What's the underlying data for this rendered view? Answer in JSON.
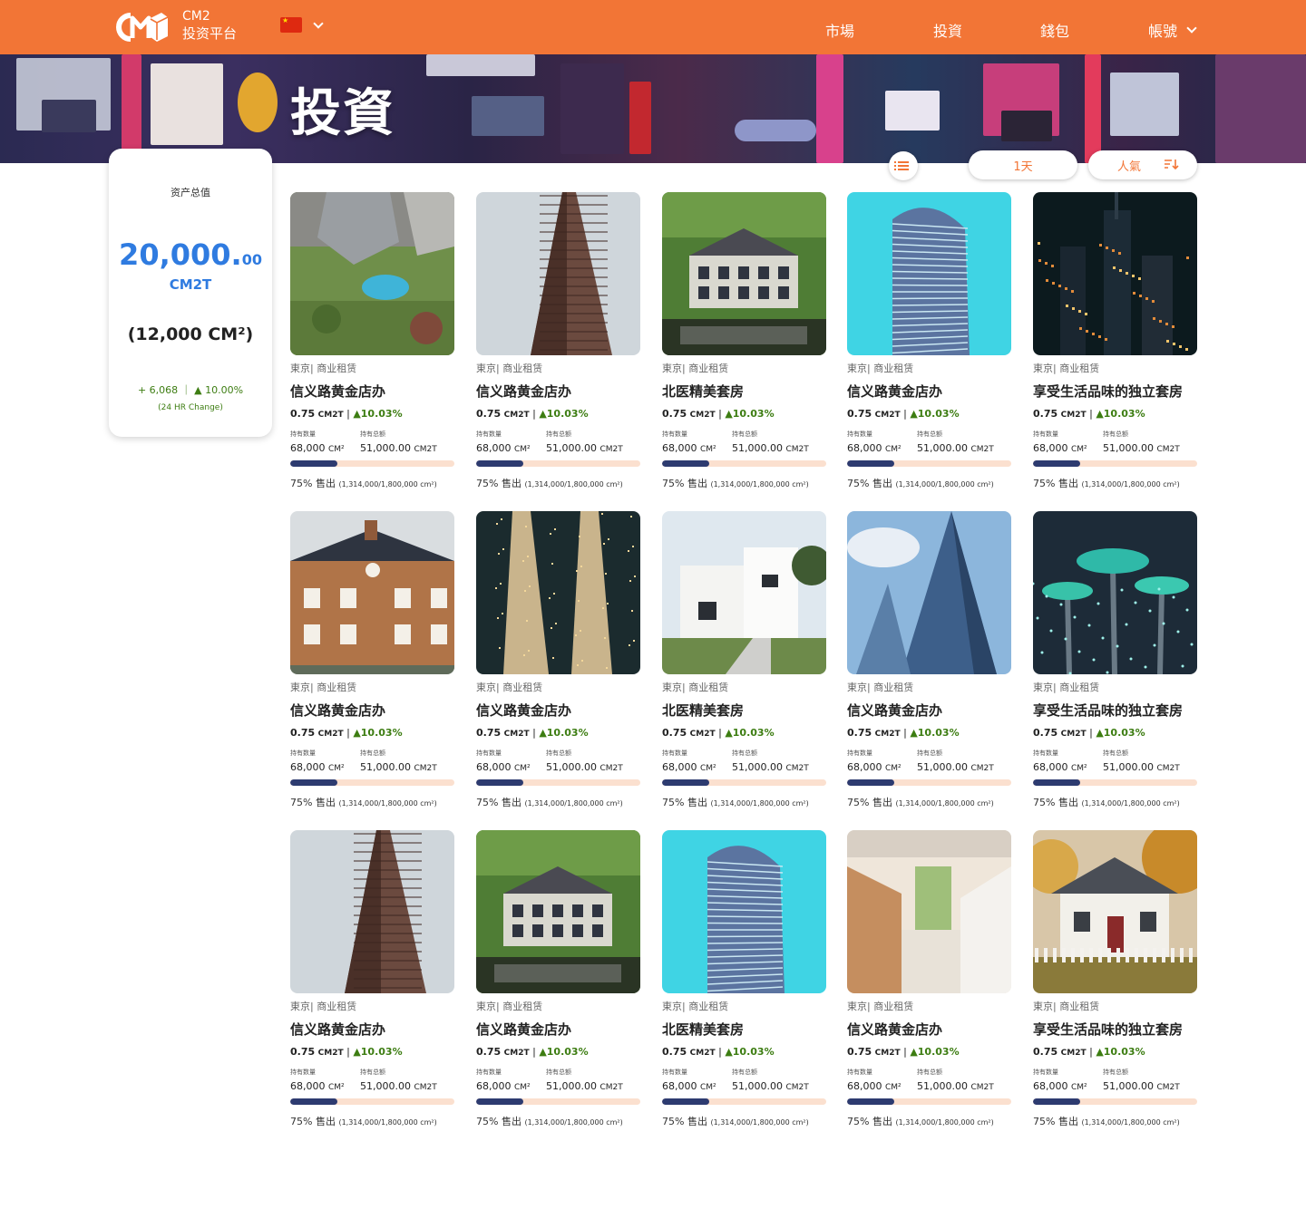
{
  "brand": {
    "line1": "CM2",
    "line2": "投资平台",
    "logo_icon": "cm2-logo-icon"
  },
  "nav": {
    "market": "市場",
    "invest": "投資",
    "wallet": "錢包",
    "account": "帳號"
  },
  "hero": {
    "title": "投資"
  },
  "summary": {
    "label": "资产总值",
    "value_main": "20,000.",
    "value_cents": "00",
    "unit": "CM2T",
    "area": "(12,000 CM²)",
    "change": "+ 6,068 ｜ ▲ 10.00%",
    "change_note": "(24 HR Change)"
  },
  "controls": {
    "period": "1天",
    "sort": "人氣"
  },
  "labels": {
    "holdings_qty": "持有数量",
    "holdings_total": "持有总额",
    "sold_word": "售出"
  },
  "colors": {
    "brand_orange": "#f27536",
    "accent_blue": "#2f7be0",
    "change_green": "#3d7d12",
    "bar_fill": "#2d3b70",
    "bar_track": "#fbe0cf"
  },
  "cards": [
    {
      "image": "aerial-house-pool",
      "category": "東京| 商业租赁",
      "name": "信义路黄金店办",
      "price": "0.75",
      "price_unit": "CM2T",
      "change": "▲10.03%",
      "qty": "68,000",
      "qty_unit": "CM²",
      "total": "51,000.00",
      "total_unit": "CM2T",
      "percent_sold": 75,
      "sold_pct_text": "75%",
      "sold_detail": "(1,314,000/1,800,000 cm²)"
    },
    {
      "image": "flatiron-building",
      "category": "東京| 商业租赁",
      "name": "信义路黄金店办",
      "price": "0.75",
      "price_unit": "CM2T",
      "change": "▲10.03%",
      "qty": "68,000",
      "qty_unit": "CM²",
      "total": "51,000.00",
      "total_unit": "CM2T",
      "percent_sold": 75,
      "sold_pct_text": "75%",
      "sold_detail": "(1,314,000/1,800,000 cm²)"
    },
    {
      "image": "manor-house-lake",
      "category": "東京| 商业租赁",
      "name": "北医精美套房",
      "price": "0.75",
      "price_unit": "CM2T",
      "change": "▲10.03%",
      "qty": "68,000",
      "qty_unit": "CM²",
      "total": "51,000.00",
      "total_unit": "CM2T",
      "percent_sold": 75,
      "sold_pct_text": "75%",
      "sold_detail": "(1,314,000/1,800,000 cm²)"
    },
    {
      "image": "glass-tower-cyan",
      "category": "東京| 商业租赁",
      "name": "信义路黄金店办",
      "price": "0.75",
      "price_unit": "CM2T",
      "change": "▲10.03%",
      "qty": "68,000",
      "qty_unit": "CM²",
      "total": "51,000.00",
      "total_unit": "CM2T",
      "percent_sold": 75,
      "sold_pct_text": "75%",
      "sold_detail": "(1,314,000/1,800,000 cm²)"
    },
    {
      "image": "night-skyline",
      "category": "東京| 商业租赁",
      "name": "享受生活品味的独立套房",
      "price": "0.75",
      "price_unit": "CM2T",
      "change": "▲10.03%",
      "qty": "68,000",
      "qty_unit": "CM²",
      "total": "51,000.00",
      "total_unit": "CM2T",
      "percent_sold": 75,
      "sold_pct_text": "75%",
      "sold_detail": "(1,314,000/1,800,000 cm²)"
    },
    {
      "image": "brick-house",
      "category": "東京| 商业租赁",
      "name": "信义路黄金店办",
      "price": "0.75",
      "price_unit": "CM2T",
      "change": "▲10.03%",
      "qty": "68,000",
      "qty_unit": "CM²",
      "total": "51,000.00",
      "total_unit": "CM2T",
      "percent_sold": 75,
      "sold_pct_text": "75%",
      "sold_detail": "(1,314,000/1,800,000 cm²)"
    },
    {
      "image": "petronas-towers-night",
      "category": "東京| 商业租赁",
      "name": "信义路黄金店办",
      "price": "0.75",
      "price_unit": "CM2T",
      "change": "▲10.03%",
      "qty": "68,000",
      "qty_unit": "CM²",
      "total": "51,000.00",
      "total_unit": "CM2T",
      "percent_sold": 75,
      "sold_pct_text": "75%",
      "sold_detail": "(1,314,000/1,800,000 cm²)"
    },
    {
      "image": "white-modern-house",
      "category": "東京| 商业租赁",
      "name": "北医精美套房",
      "price": "0.75",
      "price_unit": "CM2T",
      "change": "▲10.03%",
      "qty": "68,000",
      "qty_unit": "CM²",
      "total": "51,000.00",
      "total_unit": "CM2T",
      "percent_sold": 75,
      "sold_pct_text": "75%",
      "sold_detail": "(1,314,000/1,800,000 cm²)"
    },
    {
      "image": "glass-skyscraper-sky",
      "category": "東京| 商业租赁",
      "name": "信义路黄金店办",
      "price": "0.75",
      "price_unit": "CM2T",
      "change": "▲10.03%",
      "qty": "68,000",
      "qty_unit": "CM²",
      "total": "51,000.00",
      "total_unit": "CM2T",
      "percent_sold": 75,
      "sold_pct_text": "75%",
      "sold_detail": "(1,314,000/1,800,000 cm²)"
    },
    {
      "image": "supertree-grove",
      "category": "東京| 商业租赁",
      "name": "享受生活品味的独立套房",
      "price": "0.75",
      "price_unit": "CM2T",
      "change": "▲10.03%",
      "qty": "68,000",
      "qty_unit": "CM²",
      "total": "51,000.00",
      "total_unit": "CM2T",
      "percent_sold": 75,
      "sold_pct_text": "75%",
      "sold_detail": "(1,314,000/1,800,000 cm²)"
    },
    {
      "image": "flatiron-building",
      "category": "東京| 商业租赁",
      "name": "信义路黄金店办",
      "price": "0.75",
      "price_unit": "CM2T",
      "change": "▲10.03%",
      "qty": "68,000",
      "qty_unit": "CM²",
      "total": "51,000.00",
      "total_unit": "CM2T",
      "percent_sold": 75,
      "sold_pct_text": "75%",
      "sold_detail": "(1,314,000/1,800,000 cm²)"
    },
    {
      "image": "manor-house-lake",
      "category": "東京| 商业租赁",
      "name": "信义路黄金店办",
      "price": "0.75",
      "price_unit": "CM2T",
      "change": "▲10.03%",
      "qty": "68,000",
      "qty_unit": "CM²",
      "total": "51,000.00",
      "total_unit": "CM2T",
      "percent_sold": 75,
      "sold_pct_text": "75%",
      "sold_detail": "(1,314,000/1,800,000 cm²)"
    },
    {
      "image": "glass-tower-cyan",
      "category": "東京| 商业租赁",
      "name": "北医精美套房",
      "price": "0.75",
      "price_unit": "CM2T",
      "change": "▲10.03%",
      "qty": "68,000",
      "qty_unit": "CM²",
      "total": "51,000.00",
      "total_unit": "CM2T",
      "percent_sold": 75,
      "sold_pct_text": "75%",
      "sold_detail": "(1,314,000/1,800,000 cm²)"
    },
    {
      "image": "bright-kitchen-interior",
      "category": "東京| 商业租赁",
      "name": "信义路黄金店办",
      "price": "0.75",
      "price_unit": "CM2T",
      "change": "▲10.03%",
      "qty": "68,000",
      "qty_unit": "CM²",
      "total": "51,000.00",
      "total_unit": "CM2T",
      "percent_sold": 75,
      "sold_pct_text": "75%",
      "sold_detail": "(1,314,000/1,800,000 cm²)"
    },
    {
      "image": "white-cottage-autumn",
      "category": "東京| 商业租赁",
      "name": "享受生活品味的独立套房",
      "price": "0.75",
      "price_unit": "CM2T",
      "change": "▲10.03%",
      "qty": "68,000",
      "qty_unit": "CM²",
      "total": "51,000.00",
      "total_unit": "CM2T",
      "percent_sold": 75,
      "sold_pct_text": "75%",
      "sold_detail": "(1,314,000/1,800,000 cm²)"
    }
  ]
}
